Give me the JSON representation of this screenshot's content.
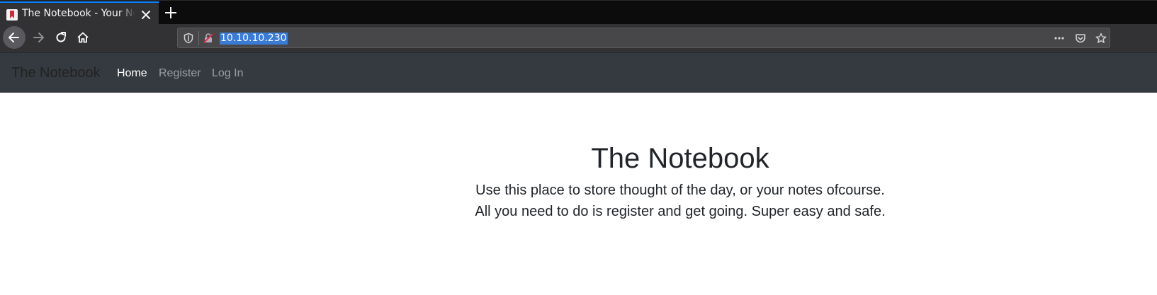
{
  "browser": {
    "tab_title": "The Notebook - Your Notes",
    "url": "10.10.10.230"
  },
  "site": {
    "brand": "The Notebook",
    "nav": [
      {
        "label": "Home",
        "active": true
      },
      {
        "label": "Register",
        "active": false
      },
      {
        "label": "Log In",
        "active": false
      }
    ]
  },
  "hero": {
    "title": "The Notebook",
    "line1": "Use this place to store thought of the day, or your notes ofcourse.",
    "line2": "All you need to do is register and get going. Super easy and safe."
  },
  "icons": {
    "tab_favicon": "notebook-bookmark-icon",
    "close": "close-icon",
    "new_tab": "plus-icon",
    "back": "arrow-left-icon",
    "forward": "arrow-right-icon",
    "reload": "reload-icon",
    "home": "home-icon",
    "tracking": "shield-icon",
    "connection": "insecure-lock-icon",
    "page_actions": "more-icon",
    "pocket": "pocket-icon",
    "bookmark": "star-icon"
  },
  "colors": {
    "accent": "#0a84ff",
    "navbar_bg": "#343a40",
    "selection": "#3a7bd5"
  }
}
